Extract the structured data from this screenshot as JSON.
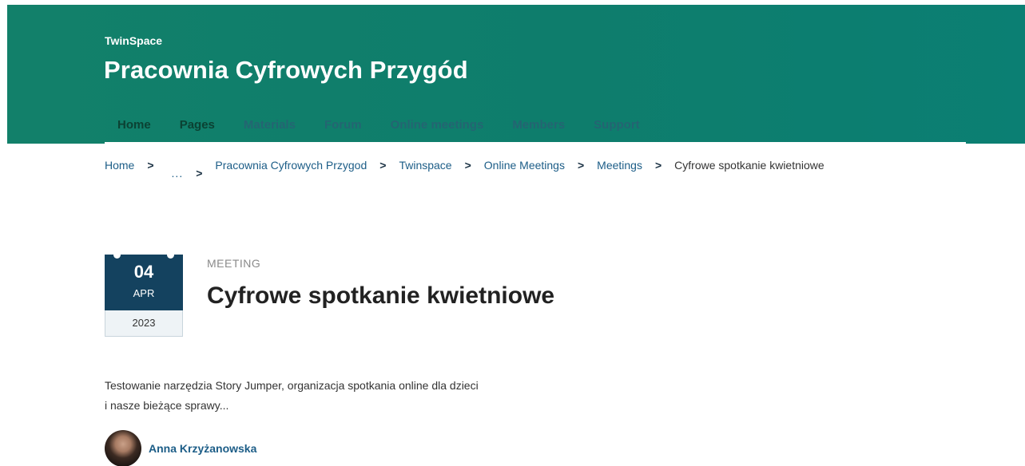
{
  "header": {
    "kicker": "TwinSpace",
    "title": "Pracownia Cyfrowych Przygód",
    "nav": [
      {
        "label": "Home"
      },
      {
        "label": "Pages"
      },
      {
        "label": "Materials"
      },
      {
        "label": "Forum"
      },
      {
        "label": "Online meetings"
      },
      {
        "label": "Members"
      },
      {
        "label": "Support"
      }
    ]
  },
  "breadcrumb": {
    "home": "Home",
    "ellipsis": "...",
    "items": [
      "Pracownia Cyfrowych Przygod",
      "Twinspace",
      "Online Meetings",
      "Meetings"
    ],
    "current": "Cyfrowe spotkanie kwietniowe",
    "separator": ">"
  },
  "event": {
    "date": {
      "day": "04",
      "month": "APR",
      "year": "2023"
    },
    "type": "MEETING",
    "title": "Cyfrowe spotkanie kwietniowe",
    "description_line1": "Testowanie narzędzia Story Jumper, organizacja spotkania online dla dzieci",
    "description_line2": "i nasze bieżące sprawy..."
  },
  "author": {
    "name": "Anna Krzyżanowska"
  },
  "colors": {
    "header_bg": "#0e7d6c",
    "date_badge": "#14425f",
    "link": "#1c5d87"
  }
}
